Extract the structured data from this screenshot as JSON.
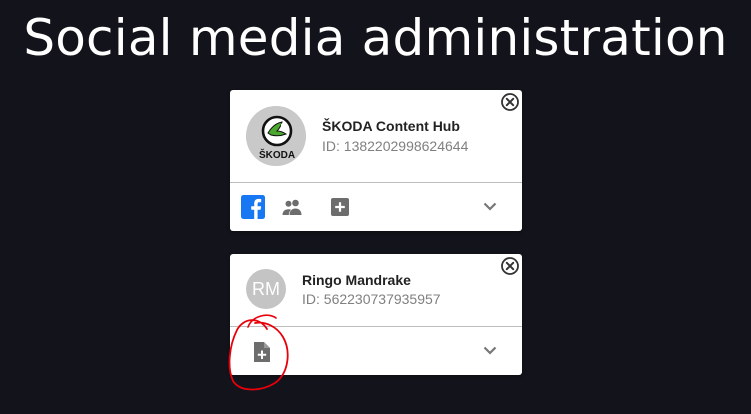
{
  "page": {
    "title": "Social media administration"
  },
  "accounts": [
    {
      "name": "ŠKODA Content Hub",
      "id_text": "ID: 1382202998624644",
      "avatar_type": "logo",
      "logo_text": "ŠKODA",
      "logo_colors": {
        "brand_green": "#4ba82e",
        "ring": "#111111"
      },
      "network_icon": "facebook-icon",
      "actions": [
        "facebook-icon",
        "followers-icon",
        "add-box-icon"
      ],
      "toggle_icon": "chevron-down-icon",
      "close_icon": "close-icon"
    },
    {
      "name": "Ringo Mandrake",
      "id_text": "ID: 562230737935957",
      "avatar_type": "initials",
      "initials": "RM",
      "actions": [
        "add-file-icon"
      ],
      "toggle_icon": "chevron-down-icon",
      "close_icon": "close-icon"
    }
  ],
  "colors": {
    "background": "#13131b",
    "facebook_blue": "#1877f2",
    "annotation_red": "#e8000b",
    "icon_gray": "#6d6d6d"
  }
}
